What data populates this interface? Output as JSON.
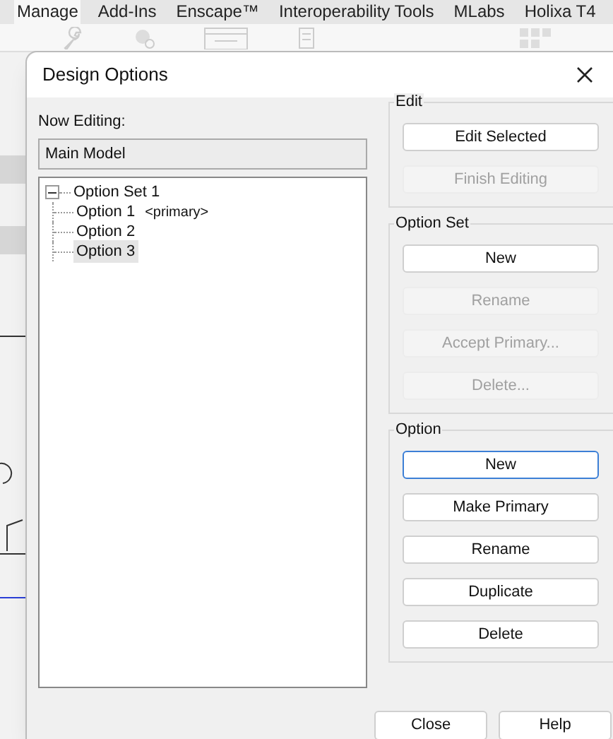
{
  "ribbon": {
    "tabs": [
      {
        "label": "Manage",
        "selected": true
      },
      {
        "label": "Add-Ins",
        "selected": false
      },
      {
        "label": "Enscape™",
        "selected": false
      },
      {
        "label": "Interoperability Tools",
        "selected": false
      },
      {
        "label": "MLabs",
        "selected": false
      },
      {
        "label": "Holixa T4",
        "selected": false
      }
    ]
  },
  "dialog": {
    "title": "Design Options",
    "now_editing_label": "Now Editing:",
    "now_editing_value": "Main Model",
    "tree": {
      "label": "Option Set 1",
      "expanded": true,
      "children": [
        {
          "label": "Option 1",
          "suffix": "<primary>",
          "selected": false
        },
        {
          "label": "Option 2",
          "selected": false
        },
        {
          "label": "Option 3",
          "selected": true
        }
      ]
    },
    "groups": [
      {
        "title": "Edit",
        "buttons": [
          {
            "label": "Edit Selected",
            "disabled": false,
            "focused": false
          },
          {
            "label": "Finish Editing",
            "disabled": true,
            "focused": false
          }
        ]
      },
      {
        "title": "Option Set",
        "buttons": [
          {
            "label": "New",
            "disabled": false,
            "focused": false
          },
          {
            "label": "Rename",
            "disabled": true,
            "focused": false
          },
          {
            "label": "Accept Primary...",
            "disabled": true,
            "focused": false
          },
          {
            "label": "Delete...",
            "disabled": true,
            "focused": false
          }
        ]
      },
      {
        "title": "Option",
        "buttons": [
          {
            "label": "New",
            "disabled": false,
            "focused": true
          },
          {
            "label": "Make Primary",
            "disabled": false,
            "focused": false
          },
          {
            "label": "Rename",
            "disabled": false,
            "focused": false
          },
          {
            "label": "Duplicate",
            "disabled": false,
            "focused": false
          },
          {
            "label": "Delete",
            "disabled": false,
            "focused": false
          }
        ]
      }
    ],
    "footer_buttons": [
      {
        "label": "Close"
      },
      {
        "label": "Help"
      }
    ]
  }
}
